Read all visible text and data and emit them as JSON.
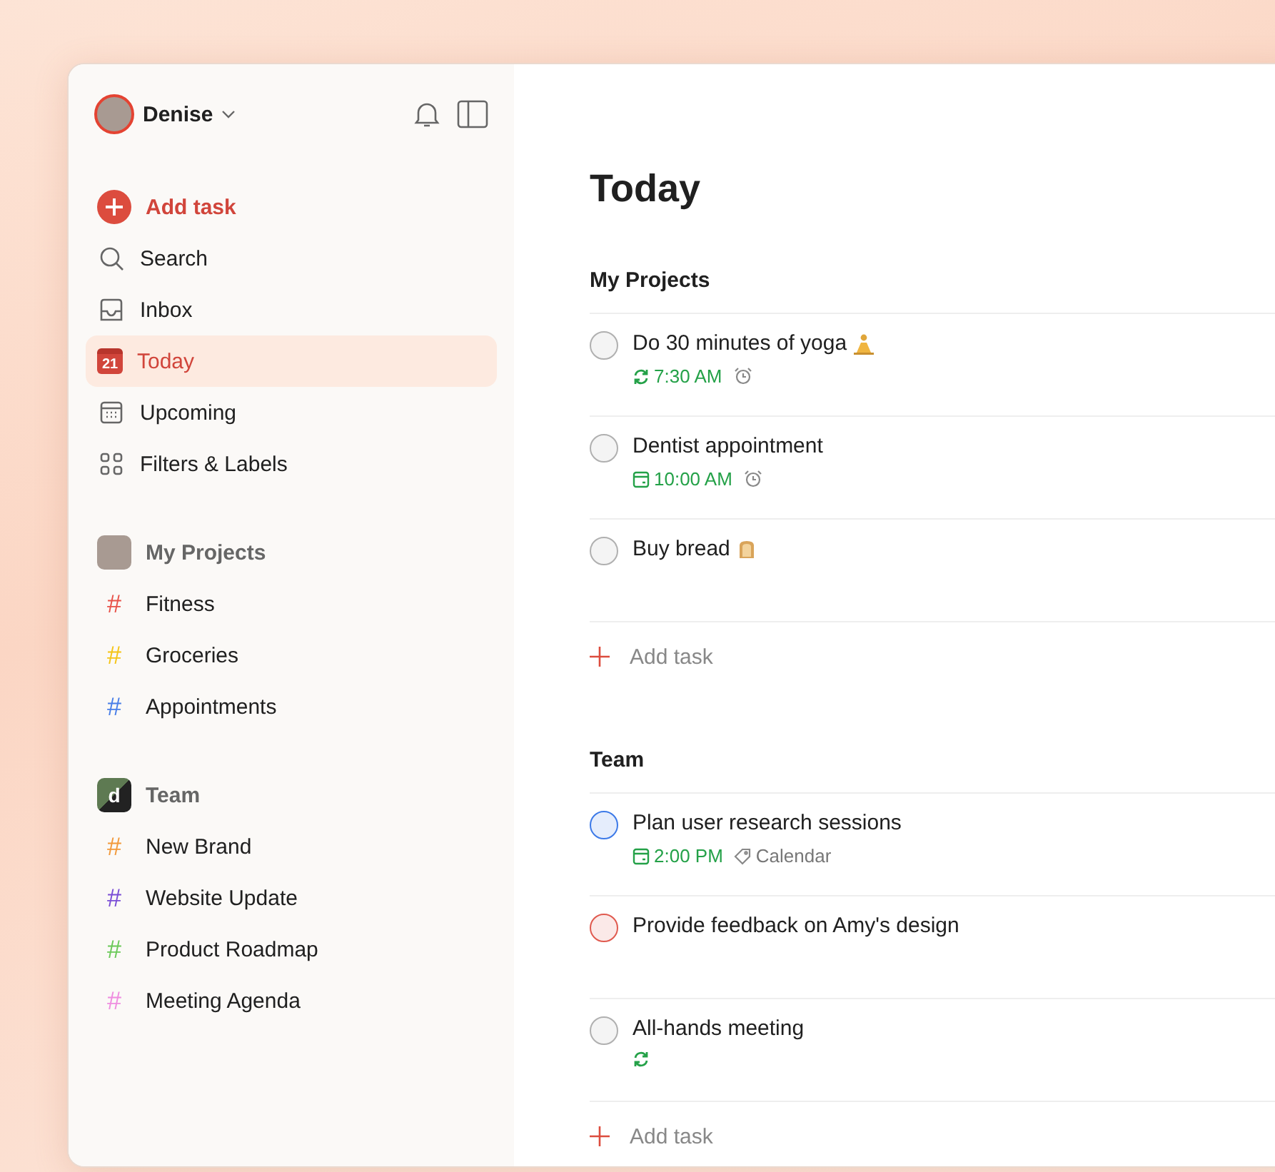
{
  "user": {
    "name": "Denise"
  },
  "nav": [
    {
      "kind": "add",
      "label": "Add task",
      "selected": false
    },
    {
      "kind": "search",
      "label": "Search",
      "selected": false
    },
    {
      "kind": "inbox",
      "label": "Inbox",
      "selected": false
    },
    {
      "kind": "today",
      "label": "Today",
      "selected": true,
      "badge": "21"
    },
    {
      "kind": "upcoming",
      "label": "Upcoming",
      "selected": false
    },
    {
      "kind": "filters",
      "label": "Filters & Labels",
      "selected": false
    }
  ],
  "groups": [
    {
      "kind": "personal",
      "title": "My Projects",
      "projects": [
        {
          "symbol": "#",
          "name": "Fitness",
          "color": "#e8534a"
        },
        {
          "symbol": "#",
          "name": "Groceries",
          "color": "#f5c518"
        },
        {
          "symbol": "#",
          "name": "Appointments",
          "color": "#4a7fe8"
        }
      ]
    },
    {
      "kind": "team",
      "title": "Team",
      "badge": "d",
      "projects": [
        {
          "symbol": "#",
          "name": "New Brand",
          "color": "#f29a3c"
        },
        {
          "symbol": "#",
          "name": "Website Update",
          "color": "#7b4fd6"
        },
        {
          "symbol": "#",
          "name": "Product Roadmap",
          "color": "#6cc95a"
        },
        {
          "symbol": "#",
          "name": "Meeting Agenda",
          "color": "#ef8ee0"
        }
      ]
    }
  ],
  "page": {
    "title": "Today"
  },
  "sections": [
    {
      "title": "My Projects",
      "tasks": [
        {
          "kind": "yoga",
          "title": "Do 30 minutes of yoga",
          "color": "#b0b0b0",
          "due": {
            "kind": "recurring",
            "time": "7:30 AM"
          },
          "alarm": true
        },
        {
          "kind": "plain",
          "title": "Dentist appointment",
          "color": "#b0b0b0",
          "due": {
            "kind": "date",
            "time": "10:00 AM"
          },
          "alarm": true
        },
        {
          "kind": "bread",
          "title": "Buy bread",
          "color": "#b0b0b0"
        }
      ],
      "add_label": "Add task"
    },
    {
      "title": "Team",
      "tasks": [
        {
          "kind": "plain",
          "title": "Plan user research sessions",
          "color": "#3d7ae8",
          "due": {
            "kind": "date",
            "time": "2:00 PM"
          },
          "alarm": false,
          "label": "Calendar"
        },
        {
          "kind": "plain",
          "title": "Provide feedback on Amy's design",
          "color": "#e05a4f"
        },
        {
          "kind": "plain",
          "title": "All-hands meeting",
          "color": "#b0b0b0",
          "due": {
            "kind": "recurring"
          },
          "alarm": false
        }
      ],
      "add_label": "Add task"
    }
  ]
}
